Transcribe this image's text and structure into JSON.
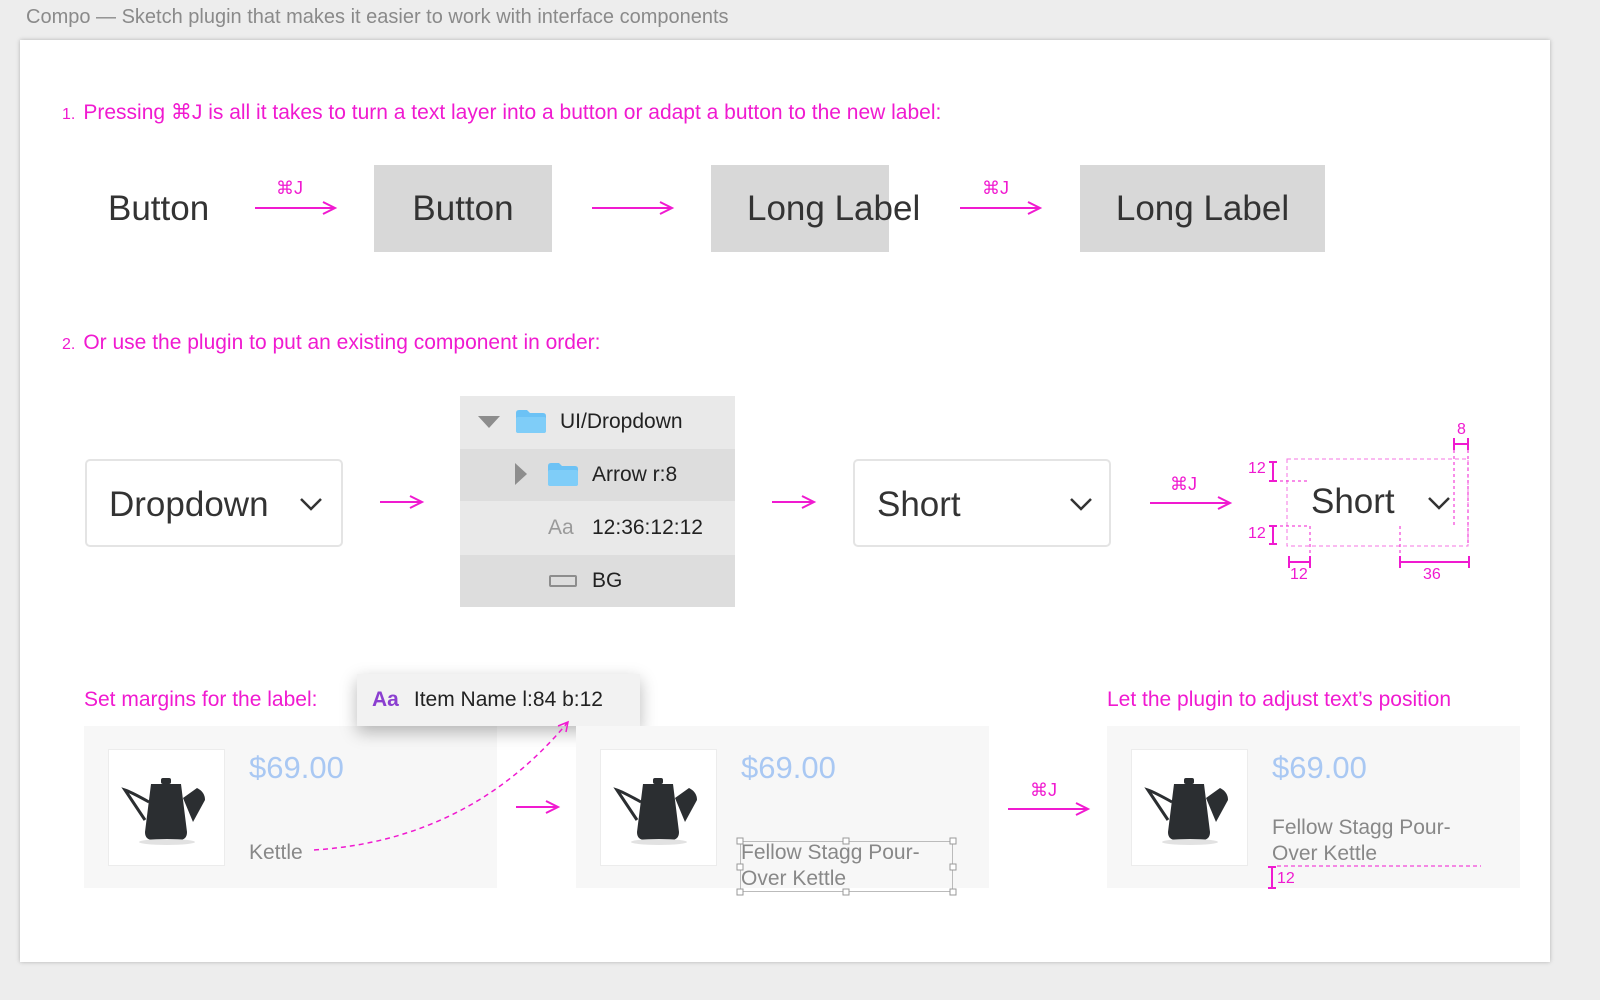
{
  "window": {
    "title": "Compo — Sketch plugin that makes it easier to work with interface components"
  },
  "step1": {
    "number": "1.",
    "text": "Pressing ⌘J is all it takes to turn a text layer into a button or adapt a button to the new label:",
    "plain_label": "Button",
    "shortcut": "⌘J",
    "button1_label": "Button",
    "long_label_overflow": "Long Label",
    "shortcut2": "⌘J",
    "button2_label": "Long Label"
  },
  "step2": {
    "number": "2.",
    "text": "Or use the plugin to put an existing component in order:",
    "dropdown_label": "Dropdown",
    "layers": [
      {
        "name": "UI/Dropdown",
        "icon": "folder-icon"
      },
      {
        "name": "Arrow r:8",
        "icon": "folder-icon"
      },
      {
        "name": "12:36:12:12",
        "icon": "text-layer-icon",
        "icon_text": "Aa"
      },
      {
        "name": "BG",
        "icon": "rectangle-layer-icon"
      }
    ],
    "short_label": "Short",
    "shortcut": "⌘J",
    "short_label_2": "Short",
    "dims": {
      "top": "12",
      "bottom": "12",
      "left": "12",
      "right": "36",
      "arrow": "8"
    }
  },
  "step3": {
    "caption_left": "Set margins for the label:",
    "tooltip_icon": "Aa",
    "tooltip_text": "Item Name l:84 b:12",
    "caption_right": "Let the plugin to adjust text’s position",
    "price": "$69.00",
    "kettle_label": "Kettle",
    "long_name_line1": "Fellow Stagg Pour-",
    "long_name_line2": "Over Kettle",
    "shortcut": "⌘J",
    "bottom_margin": "12"
  },
  "colors": {
    "accent": "#f01ad0",
    "price": "#a9c8f3",
    "button_bg": "#d8d8d8"
  }
}
